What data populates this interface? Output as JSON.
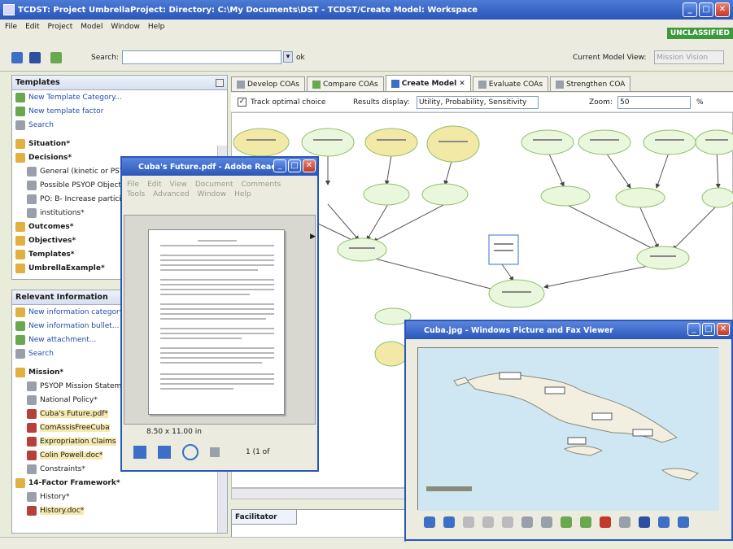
{
  "window": {
    "title": "TCDST: Project UmbrellaProject: Directory: C:\\My Documents\\DST - TCDST/Create Model: Workspace"
  },
  "menu": [
    "File",
    "Edit",
    "Project",
    "Model",
    "Window",
    "Help"
  ],
  "classification": "UNCLASSIFIED",
  "toolbar": {
    "search_label": "Search:",
    "search_value": "",
    "search_option": "ok",
    "current_model_view_label": "Current Model View:",
    "current_model_view_value": "Mission Vision"
  },
  "templates_panel": {
    "title": "Templates",
    "actions": [
      "New Template Category...",
      "New template factor",
      "Search"
    ],
    "items": [
      {
        "label": "Situation*",
        "bold": true
      },
      {
        "label": "Decisions*",
        "bold": true
      },
      {
        "label": "General (kinetic or PSYOP)",
        "bold": false
      },
      {
        "label": "Possible PSYOP Objectives",
        "bold": false
      },
      {
        "label": "PO: B- Increase participation in",
        "bold": false
      },
      {
        "label": "institutions*",
        "bold": false
      },
      {
        "label": "Outcomes*",
        "bold": true
      },
      {
        "label": "Objectives*",
        "bold": true
      },
      {
        "label": "Templates*",
        "bold": true
      },
      {
        "label": "UmbrellaExample*",
        "bold": true
      }
    ]
  },
  "info_panel": {
    "title": "Relevant Information",
    "actions": [
      "New information category...",
      "New information bullet...",
      "New attachment...",
      "Search"
    ],
    "items": [
      {
        "label": "Mission*",
        "bold": true,
        "hl": false
      },
      {
        "label": "PSYOP Mission Statement",
        "bold": false,
        "hl": false
      },
      {
        "label": "National Policy*",
        "bold": false,
        "hl": false
      },
      {
        "label": "Cuba's Future.pdf*",
        "bold": false,
        "hl": true
      },
      {
        "label": "ComAssisFreeCuba",
        "bold": false,
        "hl": true
      },
      {
        "label": "Expropriation Claims",
        "bold": false,
        "hl": true
      },
      {
        "label": "Colin Powell.doc*",
        "bold": false,
        "hl": true
      },
      {
        "label": "Constraints*",
        "bold": false,
        "hl": false
      },
      {
        "label": "14-Factor Framework*",
        "bold": true,
        "hl": false
      },
      {
        "label": "History*",
        "bold": false,
        "hl": false
      },
      {
        "label": "History.doc*",
        "bold": false,
        "hl": true
      }
    ]
  },
  "editor_tabs": [
    {
      "label": "Develop COAs",
      "active": false
    },
    {
      "label": "Compare COAs",
      "active": false
    },
    {
      "label": "Create Model",
      "active": true
    },
    {
      "label": "Evaluate COAs",
      "active": false
    },
    {
      "label": "Strengthen COA",
      "active": false
    }
  ],
  "model_bar": {
    "track_label": "Track optimal choice",
    "results_label": "Results display:",
    "results_value": "Utility, Probability, Sensitivity",
    "zoom_label": "Zoom:",
    "zoom_value": "50",
    "zoom_unit": "%"
  },
  "facilitator_tab": "Facilitator",
  "pdf_window": {
    "title": "Cuba's Future.pdf - Adobe Reader",
    "menu": [
      "File",
      "Edit",
      "View",
      "Document",
      "Comments",
      "Tools",
      "Advanced",
      "Window",
      "Help"
    ],
    "page_size": "8.50 x 11.00 in",
    "page_count": "1 (1 of"
  },
  "map_window": {
    "title": "Cuba.jpg - Windows Picture and Fax Viewer"
  },
  "colors": {
    "title_blue": "#2a56b8",
    "classified_green": "#3c9a3c",
    "node_green": "#e9f7dc",
    "node_yellow": "#f3e9a6"
  }
}
